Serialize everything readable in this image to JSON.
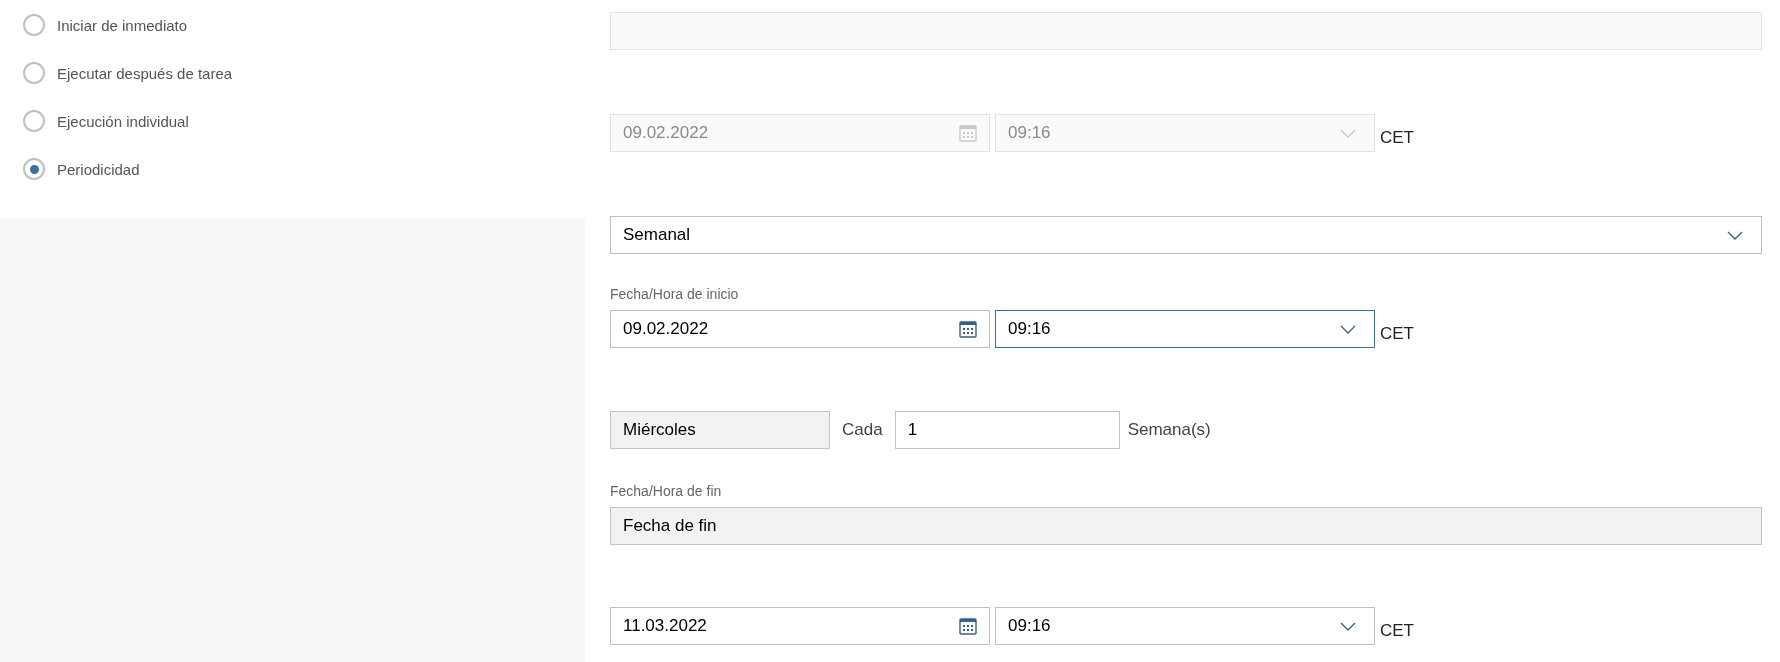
{
  "schedule_options": [
    {
      "label": "Iniciar de inmediato",
      "selected": false
    },
    {
      "label": "Ejecutar después de tarea",
      "selected": false
    },
    {
      "label": "Ejecución individual",
      "selected": false
    },
    {
      "label": "Periodicidad",
      "selected": true
    }
  ],
  "top_field": {
    "disabled": true
  },
  "fixed_start": {
    "date": "09.02.2022",
    "time": "09:16",
    "timezone": "CET",
    "disabled": true,
    "time_focused": false
  },
  "recurrence": {
    "value": "Semanal"
  },
  "start": {
    "label": "Fecha/Hora de inicio",
    "date": "09.02.2022",
    "time": "09:16",
    "timezone": "CET",
    "disabled": false,
    "time_focused": true
  },
  "weekday": {
    "value": "Miércoles",
    "readonly": true
  },
  "every_label": "Cada",
  "interval": {
    "value": "1"
  },
  "unit": "Semana(s)",
  "end": {
    "label": "Fecha/Hora de fin",
    "mode": {
      "value": "Fecha de fin",
      "readonly": true
    },
    "date": "11.03.2022",
    "time": "09:16",
    "timezone": "CET",
    "disabled": false,
    "time_focused": false
  }
}
